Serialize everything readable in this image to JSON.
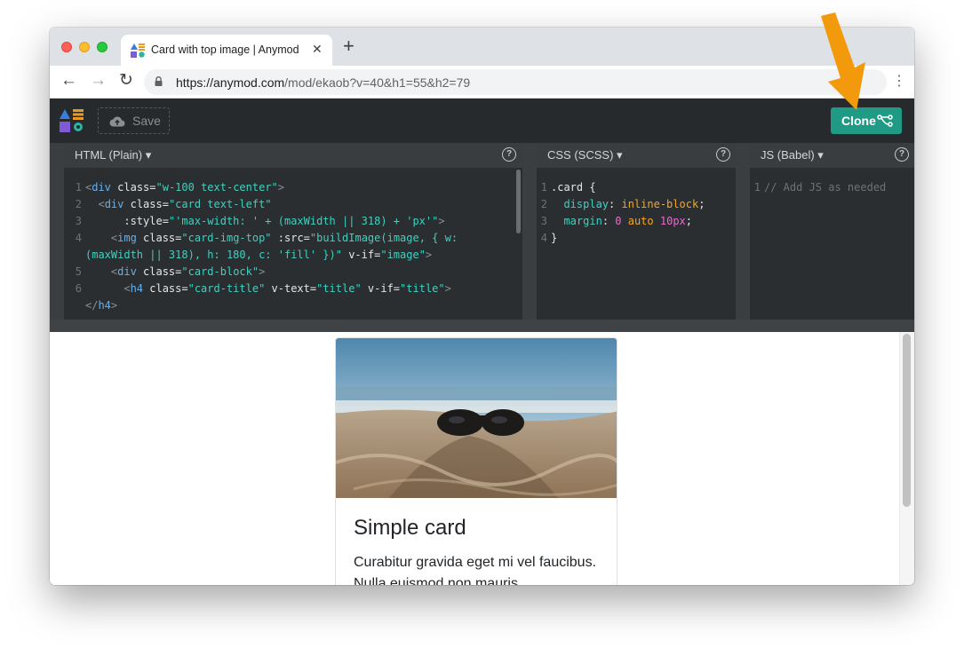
{
  "browser": {
    "tab_title": "Card with top image | Anymod",
    "url_host": "https://anymod.com",
    "url_path": "/mod/ekaob?v=40&h1=55&h2=79",
    "icons": {
      "back": "arrow-left-icon",
      "forward": "arrow-right-icon",
      "reload": "reload-icon",
      "lock": "lock-icon",
      "menu": "kebab-menu-icon",
      "new_tab": "plus-icon",
      "close_tab": "close-icon"
    }
  },
  "app": {
    "save_label": "Save",
    "clone_label": "Clone",
    "accent": "#1f9a84"
  },
  "panels": {
    "html": {
      "title": "HTML (Plain) ▾",
      "lines": [
        {
          "num": "1"
        },
        {
          "num": "2"
        },
        {
          "num": "3"
        },
        {
          "num": "4"
        },
        {
          "num": ""
        },
        {
          "num": "5"
        },
        {
          "num": "6"
        },
        {
          "num": ""
        }
      ],
      "code": {
        "l1_open": "<",
        "l1_tag": "div",
        "l1_attr": " class=",
        "l1_str": "\"w-100 text-center\"",
        "l1_close": ">",
        "l2_open": "  <",
        "l2_tag": "div",
        "l2_attr": " class=",
        "l2_str": "\"card text-left\"",
        "l3_attr": "      :style=",
        "l3_str": "\"'max-width: ' + (maxWidth || 318) + 'px'\"",
        "l3_close": ">",
        "l4_open": "    <",
        "l4_tag": "img",
        "l4_attr": " class=",
        "l4_str": "\"card-img-top\"",
        "l4_attr2": " :src=",
        "l4_str2": "\"buildImage(image, { w:",
        "l4b_str": "(maxWidth || 318), h: 180, c: 'fill' })\"",
        "l4b_attr": " v-if=",
        "l4b_str2": "\"image\"",
        "l4b_close": ">",
        "l5_open": "    <",
        "l5_tag": "div",
        "l5_attr": " class=",
        "l5_str": "\"card-block\"",
        "l5_close": ">",
        "l6_open": "      <",
        "l6_tag": "h4",
        "l6_attr": " class=",
        "l6_str": "\"card-title\"",
        "l6_attr2": " v-text=",
        "l6_str2": "\"title\"",
        "l6_attr3": " v-if=",
        "l6_str3": "\"title\"",
        "l6_close": ">",
        "l6b_open": "</",
        "l6b_tag": "h4",
        "l6b_close": ">"
      }
    },
    "css": {
      "title": "CSS (SCSS) ▾",
      "code": {
        "l1": ".card {",
        "l2_prop": "display",
        "l2_val": "inline-block",
        "l3_prop": "margin",
        "l3_n1": "0",
        "l3_v": "auto",
        "l3_n2": "10px",
        "l4": "}"
      }
    },
    "js": {
      "title": "JS (Babel) ▾",
      "placeholder": "// Add JS as needed"
    },
    "help_label": "?"
  },
  "preview": {
    "card_title": "Simple card",
    "card_text": "Curabitur gravida eget mi vel faucibus. Nulla euismod non mauris"
  },
  "annotation": {
    "arrow_color": "#f29a0c"
  }
}
